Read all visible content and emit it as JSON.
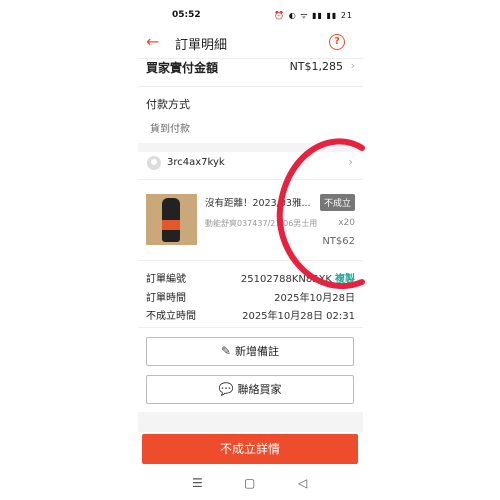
{
  "status_bar": {
    "time": "05:52",
    "icons": "⏰ ◐ ᯤ ▮▮ ▮▮ 21"
  },
  "header": {
    "title": "訂單明細",
    "back_icon": "←",
    "help_icon": "?"
  },
  "total": {
    "label": "買家實付金額",
    "value": "NT$1,285",
    "chevron": "›"
  },
  "payment": {
    "label": "付款方式",
    "value": "貨到付款"
  },
  "buyer": {
    "name": "3rc4ax7kyk",
    "chevron": "›"
  },
  "product": {
    "name": "沒有距離！2023/03雅...",
    "status_badge": "不成立",
    "variant": "動能舒爽037437/27/06男士用",
    "quantity": "x20",
    "price": "NT$62"
  },
  "order_info": {
    "order_number_label": "訂單編號",
    "order_number_value": "25102788KN85XK",
    "copy_label": "複製",
    "order_time_label": "訂單時間",
    "order_time_value": "2025年10月28日",
    "cancel_time_label": "不成立時間",
    "cancel_time_value": "2025年10月28日 02:31"
  },
  "buttons": {
    "add_note": "新增備註",
    "contact_buyer": "聯絡買家",
    "cancel_details": "不成立詳情"
  },
  "navbar": {
    "menu": "☰",
    "home": "▢",
    "back": "◁"
  },
  "colors": {
    "accent": "#ee4d2d",
    "copy": "#26aa99",
    "doodle": "#e8213f"
  }
}
